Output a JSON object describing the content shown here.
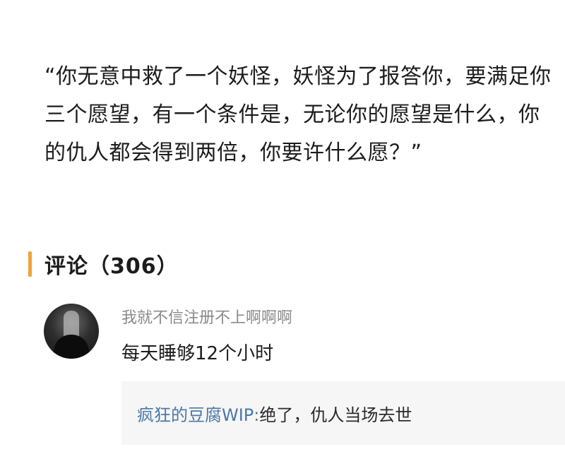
{
  "post": {
    "text": "“你无意中救了一个妖怪，妖怪为了报答你，要满足你三个愿望，有一个条件是，无论你的愿望是什么，你的仇人都会得到两倍，你要许什么愿？”"
  },
  "comments_section": {
    "title": "评论（306）",
    "accent_color": "#f0a23a"
  },
  "comment": {
    "username": "我就不信注册不上啊啊啊",
    "text": "每天睡够12个小时",
    "avatar_icon": "avatar-photo"
  },
  "reply": {
    "author": "疯狂的豆腐WIP:",
    "text": "绝了，仇人当场去世",
    "author_color": "#4a78a8"
  }
}
